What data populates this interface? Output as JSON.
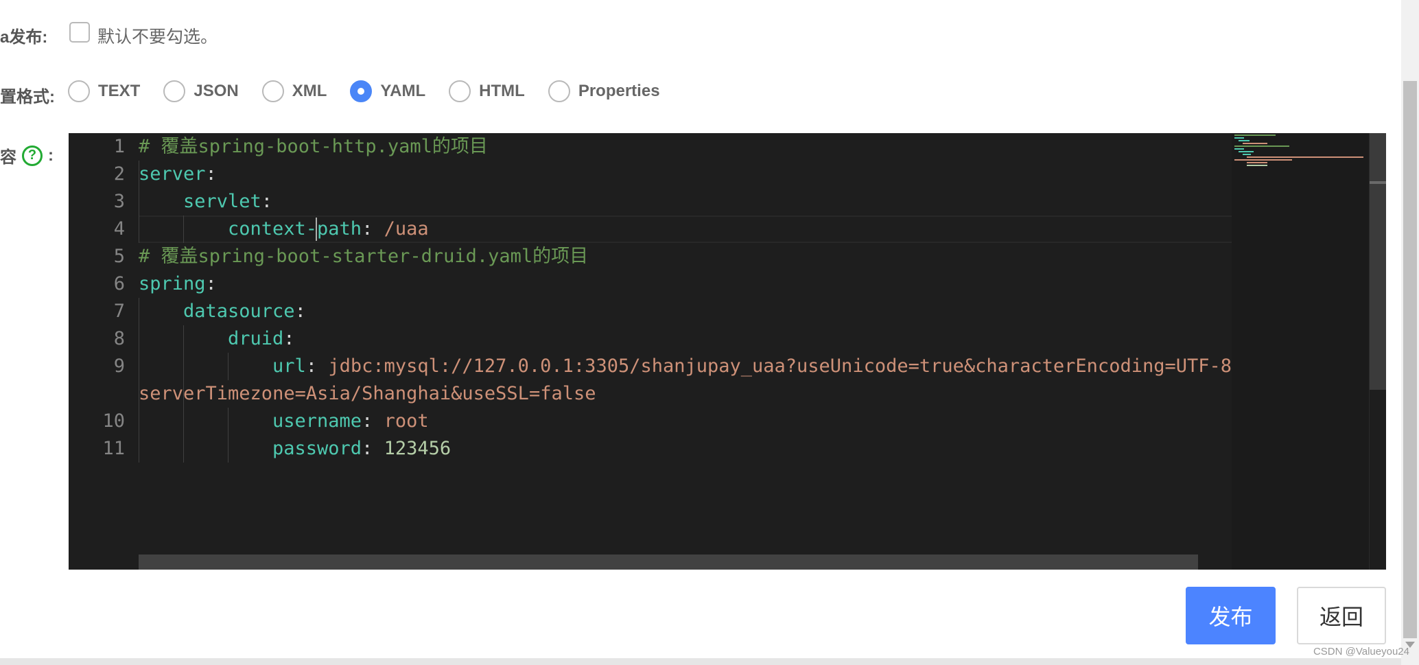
{
  "form": {
    "beta_label": "a发布:",
    "beta_checkbox_text": "默认不要勾选。",
    "format_label": "置格式:",
    "format_options": [
      "TEXT",
      "JSON",
      "XML",
      "YAML",
      "HTML",
      "Properties"
    ],
    "format_selected": "YAML",
    "content_label_start": "容",
    "content_label_end": ":",
    "help_icon": "question-circle-icon",
    "help_icon_glyph": "?"
  },
  "editor": {
    "line_numbers": [
      "1",
      "2",
      "3",
      "4",
      "5",
      "6",
      "7",
      "8",
      "9",
      "10",
      "11"
    ],
    "lines": {
      "l1": "# 覆盖spring-boot-http.yaml的项目",
      "l2_key": "server",
      "l3_key": "servlet",
      "l4_key": "context-path",
      "l4_val": "/uaa",
      "l5": "# 覆盖spring-boot-starter-druid.yaml的项目",
      "l6_key": "spring",
      "l7_key": "datasource",
      "l8_key": "druid",
      "l9_key": "url",
      "l9_val": "jdbc:mysql://127.0.0.1:3305/shanjupay_uaa?useUnicode=true&characterEncoding=UTF-8",
      "l9_wrap": "serverTimezone=Asia/Shanghai&useSSL=false",
      "l10_key": "username",
      "l10_val": "root",
      "l11_key": "password",
      "l11_val": "123456",
      "colon": ":"
    },
    "colors": {
      "background": "#1e1e1e",
      "comment": "#6a9955",
      "key": "#4ec9b0",
      "string": "#ce9178",
      "number": "#b5cea8"
    }
  },
  "buttons": {
    "publish": "发布",
    "back": "返回"
  },
  "watermark": "CSDN @Valueyou24",
  "accent_color": "#4c84ff"
}
